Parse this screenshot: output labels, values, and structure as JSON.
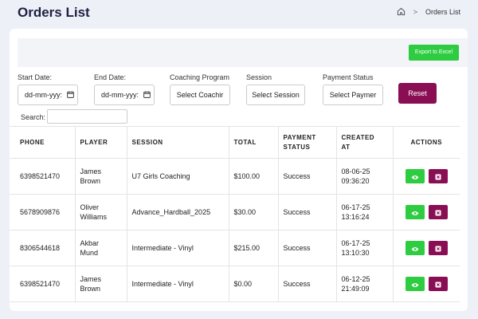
{
  "header": {
    "title": "Orders List",
    "breadcrumb": {
      "separator": ">",
      "current": "Orders List"
    }
  },
  "toolbar": {
    "export_label": "Export to Excel"
  },
  "filters": {
    "start_date": {
      "label": "Start Date:",
      "value": "dd-mm-yyy:"
    },
    "end_date": {
      "label": "End Date:",
      "value": "dd-mm-yyy:"
    },
    "coaching_program": {
      "label": "Coaching Program",
      "value": "Select Coachir"
    },
    "session": {
      "label": "Session",
      "value": "Select Session"
    },
    "payment_status": {
      "label": "Payment Status",
      "value": "Select Paymer"
    },
    "reset_label": "Reset"
  },
  "search": {
    "label": "Search:",
    "value": ""
  },
  "table": {
    "columns": {
      "phone": "PHONE",
      "player": "PLAYER",
      "session": "SESSION",
      "total": "TOTAL",
      "payment_status": [
        "PAYMENT",
        "STATUS"
      ],
      "created_at": [
        "CREATED",
        "AT"
      ],
      "actions": "ACTIONS"
    },
    "rows": [
      {
        "phone": "6398521470",
        "player": [
          "James",
          "Brown"
        ],
        "session": "U7 Girls Coaching",
        "total": "$100.00",
        "status": "Success",
        "created": [
          "08-06-25",
          "09:36:20"
        ]
      },
      {
        "phone": "5678909876",
        "player": [
          "Oliver",
          "Williams"
        ],
        "session": "Advance_Hardball_2025",
        "total": "$30.00",
        "status": "Success",
        "created": [
          "06-17-25",
          "13:16:24"
        ]
      },
      {
        "phone": "8306544618",
        "player": [
          "Akbar",
          "Mund"
        ],
        "session": "Intermediate - Vinyl",
        "total": "$215.00",
        "status": "Success",
        "created": [
          "06-17-25",
          "13:10:30"
        ]
      },
      {
        "phone": "6398521470",
        "player": [
          "James",
          "Brown"
        ],
        "session": "Intermediate - Vinyl",
        "total": "$0.00",
        "status": "Success",
        "created": [
          "06-12-25",
          "21:49:09"
        ]
      }
    ]
  },
  "colors": {
    "accent_green": "#2ecc40",
    "accent_magenta": "#8a0e54",
    "title": "#1e2044",
    "background": "#eef0f7"
  },
  "icons": {
    "home": "home-icon",
    "calendar": "calendar-icon",
    "view": "eye-icon",
    "delete": "close-square-icon"
  }
}
